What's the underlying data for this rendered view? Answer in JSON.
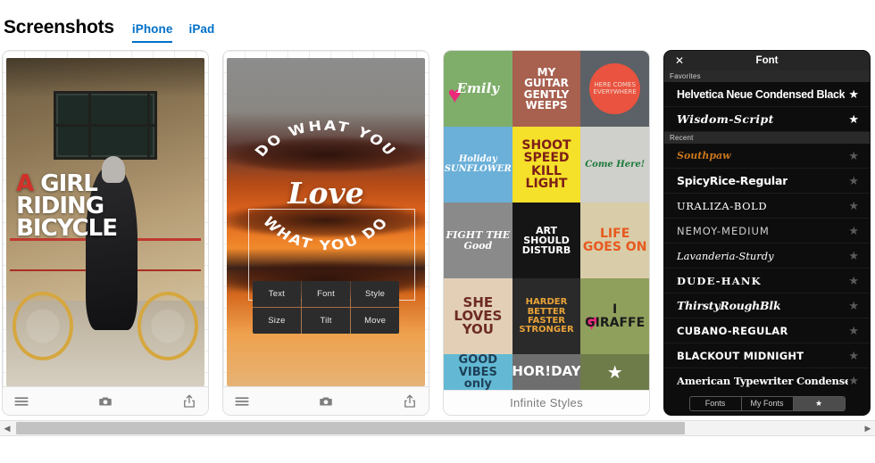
{
  "header": {
    "title": "Screenshots",
    "tabs": [
      {
        "label": "iPhone",
        "active": true
      },
      {
        "label": "iPad",
        "active": false
      }
    ]
  },
  "shots": {
    "shot1": {
      "overlay_line1_accent": "A",
      "overlay_line1": " GIRL",
      "overlay_line2": "RIDING",
      "overlay_line3": "BICYCLE",
      "toolbar": {
        "menu": "menu-icon",
        "camera": "camera-icon",
        "share": "share-icon"
      }
    },
    "shot2": {
      "arc_top": "DO WHAT YOU",
      "script_word": "Love",
      "arc_bottom": "WHAT YOU DO",
      "buttons": [
        "Text",
        "Font",
        "Style",
        "Size",
        "Tilt",
        "Move"
      ],
      "toolbar": {
        "menu": "menu-icon",
        "camera": "camera-icon",
        "share": "share-icon"
      }
    },
    "shot3": {
      "caption": "Infinite Styles",
      "cells": [
        {
          "text": "Emily",
          "bg": "#7fae6b",
          "color": "#ffffff",
          "size": 15,
          "style": "script",
          "heart": true
        },
        {
          "text": "MY GUITAR GENTLY WEEPS",
          "bg": "#a8604f",
          "color": "#ffffff",
          "size": 12,
          "style": "block"
        },
        {
          "text": "HERE COMES EVERYWHERE",
          "bg": "#5b6166",
          "color": "#f3d9cf",
          "size": 7,
          "style": "thin",
          "circle": "#e9533f"
        },
        {
          "text": "Holiday SUNFLOWER",
          "bg": "#6bb0d8",
          "color": "#ffffff",
          "size": 10,
          "style": "script"
        },
        {
          "text": "SHOOT SPEED KILL LIGHT",
          "bg": "#f5e02a",
          "color": "#7d1f17",
          "size": 14,
          "style": "block"
        },
        {
          "text": "Come Here!",
          "bg": "#cfcfcb",
          "color": "#1c7a3a",
          "size": 10,
          "style": "script"
        },
        {
          "text": "FIGHT THE Good",
          "bg": "#8a8a8a",
          "color": "#ffffff",
          "size": 11,
          "style": "script"
        },
        {
          "text": "ART SHOULD DISTURB",
          "bg": "#151515",
          "color": "#ffffff",
          "size": 11,
          "style": "block"
        },
        {
          "text": "LIFE GOES ON",
          "bg": "#d8cda8",
          "color": "#e8591f",
          "size": 14,
          "style": "block"
        },
        {
          "text": "SHE LOVES YOU",
          "bg": "#e2cfb6",
          "color": "#6d2b24",
          "size": 15,
          "style": "block"
        },
        {
          "text": "HARDER BETTER FASTER STRONGER",
          "bg": "#2a2a2a",
          "color": "#e8a33a",
          "size": 10,
          "style": "block"
        },
        {
          "text": "I GIRAFFE",
          "bg": "#8fa05c",
          "color": "#1b1b1b",
          "size": 14,
          "style": "block",
          "heart": true
        }
      ],
      "row4": [
        {
          "text": "GOOD VIBES only",
          "bg": "#63b9d4",
          "color": "#1d3f57",
          "size": 13
        },
        {
          "text": "HOR!DAY",
          "bg": "#6e6e6e",
          "color": "#ffffff",
          "size": 15
        },
        {
          "text": "★",
          "bg": "#6e7c4a",
          "color": "#ffffff",
          "size": 20
        }
      ]
    },
    "shot4": {
      "close_icon": "close-icon",
      "title": "Font",
      "sections": [
        {
          "label": "Favorites",
          "items": [
            {
              "name": "Helvetica Neue Condensed Black",
              "class": "f-helv",
              "starred": true
            },
            {
              "name": "Wisdom-Script",
              "class": "f-script",
              "starred": true
            }
          ]
        },
        {
          "label": "Recent",
          "items": [
            {
              "name": "Southpaw",
              "class": "f-south",
              "starred": false
            },
            {
              "name": "SpicyRice-Regular",
              "class": "f-spicy",
              "starred": false
            },
            {
              "name": "URALIZA-BOLD",
              "class": "f-uraliza",
              "starred": false
            },
            {
              "name": "NEMOY-MEDIUM",
              "class": "f-nemoy",
              "starred": false
            },
            {
              "name": "Lavanderia-Sturdy",
              "class": "f-lav",
              "starred": false
            },
            {
              "name": "DUDE-HANK",
              "class": "f-dude",
              "starred": false
            },
            {
              "name": "ThirstyRoughBlk",
              "class": "f-thirsty",
              "starred": false
            },
            {
              "name": "CUBANO-REGULAR",
              "class": "f-cubano",
              "starred": false
            },
            {
              "name": "BLACKOUT MIDNIGHT",
              "class": "f-blackout",
              "starred": false
            },
            {
              "name": "American Typewriter Condensed Bold",
              "class": "f-amtype",
              "starred": false
            }
          ]
        }
      ],
      "star_glyph": "★",
      "segmented": [
        {
          "label": "Fonts",
          "selected": false
        },
        {
          "label": "My Fonts",
          "selected": false
        },
        {
          "label": "★",
          "selected": true
        }
      ]
    }
  },
  "scrollbar": {
    "left_arrow": "◀",
    "right_arrow": "▶",
    "thumb_position": 0
  },
  "colors": {
    "accent_link": "#0070c9",
    "panel_border": "#dddddd",
    "dark_panel": "#0d0d0d",
    "scrollbar_thumb": "#c2c2c2"
  }
}
